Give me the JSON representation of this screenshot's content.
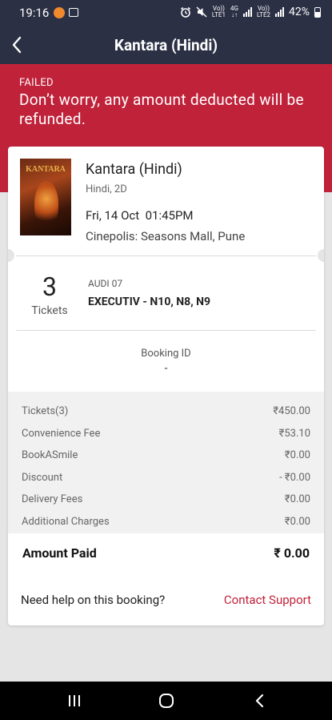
{
  "status_bar": {
    "time": "19:16",
    "net1_top": "Vo))",
    "net1_bottom": "LTE1",
    "net_4g_top": "4G",
    "net_4g_bottom": "↓↑",
    "net2_top": "Vo))",
    "net2_bottom": "LTE2",
    "battery": "42%",
    "icons": [
      "notification-dot-icon",
      "gallery-icon",
      "alarm-icon",
      "mute-icon",
      "signal-icon",
      "battery-icon"
    ]
  },
  "app_bar": {
    "title": "Kantara (Hindi)",
    "back_icon": "back-arrow-icon"
  },
  "banner": {
    "label": "FAILED",
    "message": "Don’t worry, any amount deducted will be refunded.",
    "color": "#c0223a"
  },
  "booking": {
    "poster_text": "KANTARA",
    "movie_title": "Kantara (Hindi)",
    "language_format": "Hindi, 2D",
    "datetime": "Fri, 14 Oct  01:45PM",
    "venue": "Cinepolis: Seasons Mall, Pune",
    "ticket_count": "3",
    "ticket_word": "Tickets",
    "audi": "AUDI 07",
    "seats": "EXECUTIV - N10, N8, N9",
    "booking_id_label": "Booking ID",
    "booking_id_value": "-"
  },
  "fees": [
    {
      "label": "Tickets(3)",
      "value": "₹450.00"
    },
    {
      "label": "Convenience Fee",
      "value": "₹53.10"
    },
    {
      "label": "BookASmile",
      "value": "₹0.00"
    },
    {
      "label": "Discount",
      "value": "- ₹0.00"
    },
    {
      "label": "Delivery Fees",
      "value": "₹0.00"
    },
    {
      "label": "Additional Charges",
      "value": "₹0.00"
    }
  ],
  "amount_paid": {
    "label": "Amount Paid",
    "value": "₹ 0.00"
  },
  "help": {
    "text": "Need help on this booking?",
    "link": "Contact Support"
  },
  "nav_bar": {
    "icons": [
      "recents-icon",
      "home-icon",
      "back-icon"
    ]
  }
}
